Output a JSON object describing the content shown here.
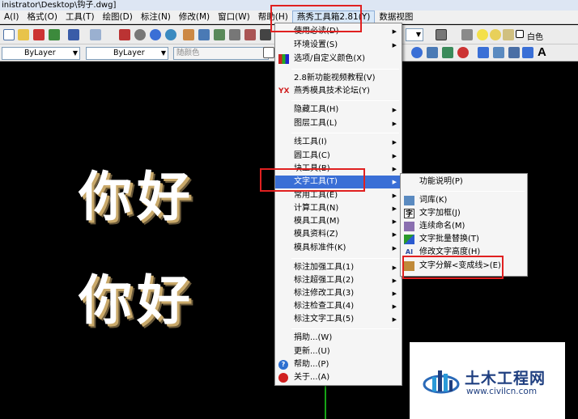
{
  "window": {
    "title": "inistrator\\Desktop\\钩子.dwg]"
  },
  "menubar": {
    "items": [
      {
        "label": "A(I)"
      },
      {
        "label": "格式(O)"
      },
      {
        "label": "工具(T)"
      },
      {
        "label": "绘图(D)"
      },
      {
        "label": "标注(N)"
      },
      {
        "label": "修改(M)"
      },
      {
        "label": "窗口(W)"
      },
      {
        "label": "帮助(H)"
      },
      {
        "label": "燕秀工具箱2.81(Y)"
      },
      {
        "label": "数据视图"
      }
    ]
  },
  "toolbar": {
    "linetype_combo": "ByLayer",
    "lineweight_combo": "ByLayer",
    "color_combo": "随颜色",
    "layer_color": "白色",
    "text_icon": "A"
  },
  "canvas": {
    "text_line1": "你好",
    "text_line2": "你好"
  },
  "main_menu": {
    "items": [
      {
        "label": "使用必读(D)",
        "sub": true
      },
      {
        "label": "环境设置(S)",
        "sub": true
      },
      {
        "label": "选项/自定义颜色(X)",
        "sub": false,
        "icon": "palette-icon"
      },
      {
        "label": "2.8新功能视频教程(V)",
        "sub": false
      },
      {
        "label": "燕秀模具技术论坛(Y)",
        "sub": false,
        "icon": "yx-logo-icon",
        "icon_text": "YX"
      },
      {
        "label": "隐藏工具(H)",
        "sub": true
      },
      {
        "label": "图层工具(L)",
        "sub": true
      },
      {
        "label": "线工具(I)",
        "sub": true
      },
      {
        "label": "圆工具(C)",
        "sub": true
      },
      {
        "label": "块工具(B)",
        "sub": true
      },
      {
        "label": "文字工具(T)",
        "sub": true
      },
      {
        "label": "常用工具(E)",
        "sub": true
      },
      {
        "label": "计算工具(N)",
        "sub": true
      },
      {
        "label": "模具工具(M)",
        "sub": true
      },
      {
        "label": "模具资料(Z)",
        "sub": true
      },
      {
        "label": "模具标准件(K)",
        "sub": true
      },
      {
        "label": "标注加强工具(1)",
        "sub": true
      },
      {
        "label": "标注超强工具(2)",
        "sub": true
      },
      {
        "label": "标注修改工具(3)",
        "sub": true
      },
      {
        "label": "标注检查工具(4)",
        "sub": true
      },
      {
        "label": "标注文字工具(5)",
        "sub": true
      },
      {
        "label": "捐助...(W)",
        "sub": false
      },
      {
        "label": "更新...(U)",
        "sub": false
      },
      {
        "label": "帮助...(P)",
        "sub": false,
        "icon": "help-icon",
        "icon_text": "?"
      },
      {
        "label": "关于...(A)",
        "sub": false,
        "icon": "about-icon"
      }
    ]
  },
  "text_submenu": {
    "items": [
      {
        "label": "功能说明(P)"
      },
      {
        "label": "词库(K)",
        "icon": "dictionary-icon"
      },
      {
        "label": "文字加框(J)",
        "icon": "text-frame-icon",
        "icon_text": "字"
      },
      {
        "label": "连续命名(M)",
        "icon": "sequential-naming-icon"
      },
      {
        "label": "文字批量替换(T)",
        "icon": "batch-replace-icon"
      },
      {
        "label": "修改文字高度(H)",
        "icon": "text-height-icon",
        "icon_text": "AI"
      },
      {
        "label": "文字分解<变成线>(E)",
        "icon": "text-explode-icon"
      }
    ]
  },
  "watermark": {
    "name": "土木工程网",
    "url": "www.civilcn.com"
  },
  "colors": {
    "highlight": "#3a6fd6",
    "annotation_red": "#e02020",
    "brand_blue": "#1f3f80"
  }
}
